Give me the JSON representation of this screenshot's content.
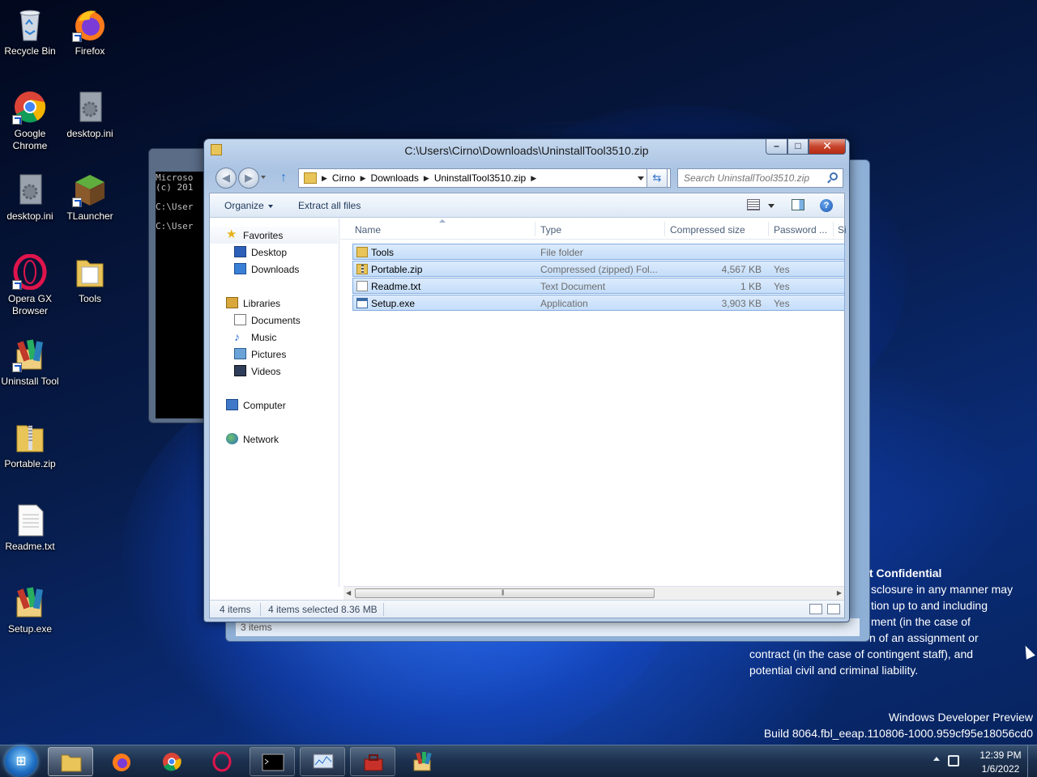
{
  "desktop": {
    "icons": [
      {
        "label": "Recycle Bin",
        "icon": "recycle-bin-icon"
      },
      {
        "label": "Firefox",
        "icon": "firefox-icon"
      },
      {
        "label": "Google Chrome",
        "icon": "chrome-icon"
      },
      {
        "label": "desktop.ini",
        "icon": "settings-file-icon"
      },
      {
        "label": "desktop.ini",
        "icon": "settings-file-icon"
      },
      {
        "label": "TLauncher",
        "icon": "tlauncher-icon"
      },
      {
        "label": "Opera GX Browser",
        "icon": "opera-gx-icon"
      },
      {
        "label": "Tools",
        "icon": "folder-icon"
      },
      {
        "label": "Uninstall Tool",
        "icon": "archive-app-icon"
      },
      {
        "label": "Portable.zip",
        "icon": "zip-folder-icon"
      },
      {
        "label": "Readme.txt",
        "icon": "text-file-icon"
      },
      {
        "label": "Setup.exe",
        "icon": "archive-app-icon"
      }
    ]
  },
  "cmd": {
    "lines": [
      "Microso",
      "(c) 201",
      "",
      "C:\\User",
      "",
      "C:\\User"
    ]
  },
  "back_window": {
    "status": "3 items"
  },
  "explorer": {
    "title": "C:\\Users\\Cirno\\Downloads\\UninstallTool3510.zip",
    "caption": {
      "minimize": "–",
      "maximize": "□",
      "close": "✕"
    },
    "address": {
      "crumbs": [
        "Cirno",
        "Downloads",
        "UninstallTool3510.zip"
      ]
    },
    "search": {
      "placeholder": "Search UninstallTool3510.zip"
    },
    "toolbar": {
      "organize": "Organize",
      "extract": "Extract all files",
      "help": "?"
    },
    "nav": {
      "favorites": "Favorites",
      "desktop": "Desktop",
      "downloads": "Downloads",
      "libraries": "Libraries",
      "documents": "Documents",
      "music": "Music",
      "pictures": "Pictures",
      "videos": "Videos",
      "computer": "Computer",
      "network": "Network"
    },
    "columns": {
      "name": "Name",
      "type": "Type",
      "size": "Compressed size",
      "password": "Password ...",
      "extra": "Si"
    },
    "files": [
      {
        "name": "Tools",
        "type": "File folder",
        "size": "",
        "password": "",
        "icon": "folder-icon"
      },
      {
        "name": "Portable.zip",
        "type": "Compressed (zipped) Fol...",
        "size": "4,567 KB",
        "password": "Yes",
        "icon": "zip-folder-icon"
      },
      {
        "name": "Readme.txt",
        "type": "Text Document",
        "size": "1 KB",
        "password": "Yes",
        "icon": "text-file-icon"
      },
      {
        "name": "Setup.exe",
        "type": "Application",
        "size": "3,903 KB",
        "password": "Yes",
        "icon": "application-icon"
      }
    ],
    "status": {
      "count": "4 items",
      "selected": "4 items selected",
      "size": "8.36 MB"
    }
  },
  "confidential": {
    "lines": [
      "t Confidential",
      "sclosure in any manner may",
      "tion up to and including",
      "ment (in the case of",
      "n of an assignment or",
      "contract (in the case of contingent staff), and",
      "potential civil and criminal liability."
    ]
  },
  "build": {
    "line1": "Windows Developer Preview",
    "line2": "Build 8064.fbl_eeap.110806-1000.959cf95e18056cd0"
  },
  "taskbar": {
    "apps": [
      "explorer",
      "firefox",
      "chrome",
      "opera-gx",
      "command-prompt",
      "performance-monitor",
      "toolbox",
      "uninstall-tool"
    ],
    "start": "⊞",
    "clock": {
      "time": "12:39 PM",
      "date": "1/6/2022"
    }
  }
}
